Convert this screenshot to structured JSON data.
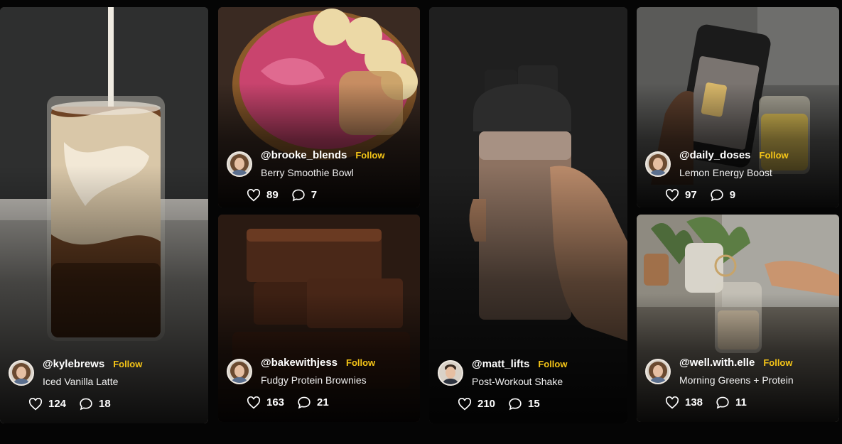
{
  "feed": [
    {
      "handle": "@kylebrews",
      "follow_label": "Follow",
      "caption": "Iced Vanilla Latte",
      "likes": "124",
      "comments": "18",
      "heart_icon": "heart-icon",
      "comment_icon": "comment-icon"
    },
    {
      "handle": "@brooke_blends",
      "follow_label": "Follow",
      "caption": "Berry Smoothie Bowl",
      "likes": "89",
      "comments": "7",
      "heart_icon": "heart-icon",
      "comment_icon": "comment-icon"
    },
    {
      "handle": "@bakewithjess",
      "follow_label": "Follow",
      "caption": "Fudgy Protein Brownies",
      "likes": "163",
      "comments": "21",
      "heart_icon": "heart-icon",
      "comment_icon": "comment-icon"
    },
    {
      "handle": "@matt_lifts",
      "follow_label": "Follow",
      "caption": "Post-Workout Shake",
      "likes": "210",
      "comments": "15",
      "heart_icon": "heart-icon",
      "comment_icon": "comment-icon"
    },
    {
      "handle": "@daily_doses",
      "follow_label": "Follow",
      "caption": "Lemon Energy Boost",
      "likes": "97",
      "comments": "9",
      "heart_icon": "heart-icon",
      "comment_icon": "comment-icon"
    },
    {
      "handle": "@well.with.elle",
      "follow_label": "Follow",
      "caption": "Morning Greens + Protein",
      "likes": "138",
      "comments": "11",
      "heart_icon": "heart-icon",
      "comment_icon": "comment-icon"
    }
  ],
  "colors": {
    "follow": "#f5c517",
    "background": "#050505"
  }
}
